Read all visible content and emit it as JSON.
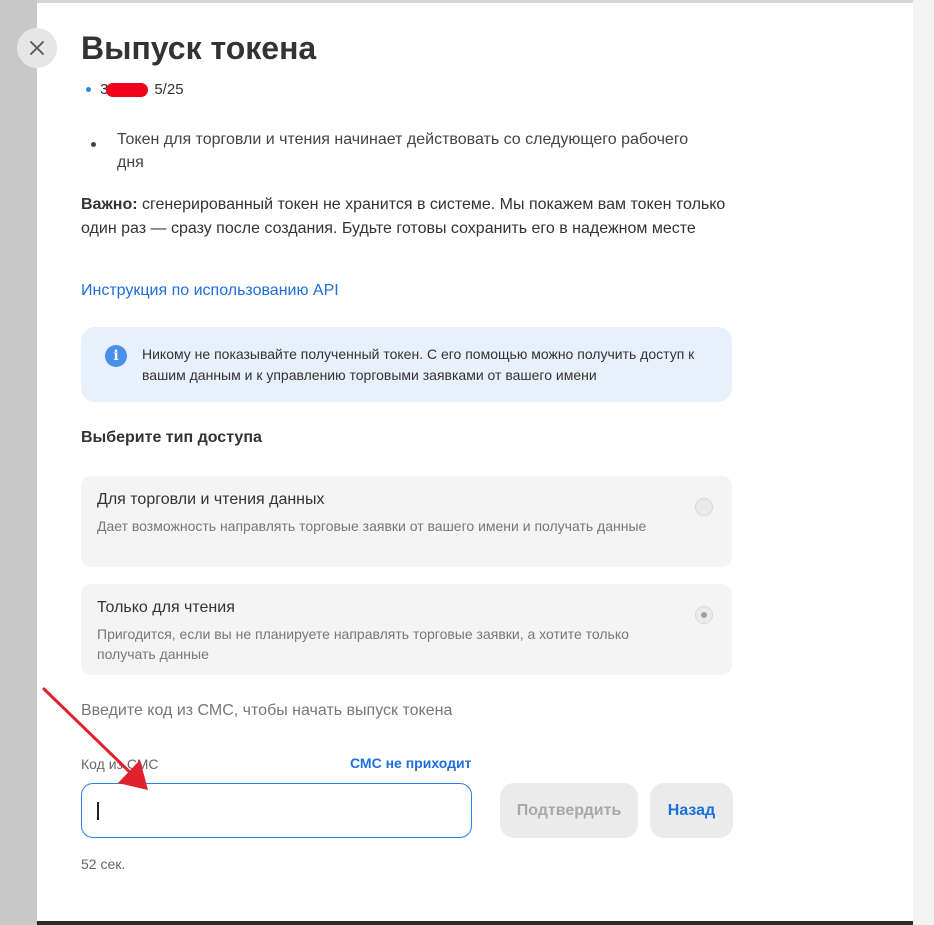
{
  "header": {
    "title": "Выпуск токена",
    "close_icon": "close-icon"
  },
  "subheader": {
    "visible_prefix": "3",
    "visible_suffix": "5/25"
  },
  "bullets": {
    "line1": "Токен для торговли и чтения начинает действовать со следующего рабочего",
    "line2": "дня"
  },
  "important": {
    "label": "Важно:",
    "text": " сгенерированный токен не хранится в системе. Мы покажем вам токен только один раз — сразу после создания. Будьте готовы сохранить его в надежном месте"
  },
  "api_link": "Инструкция по использованию API",
  "info": {
    "icon": "info-icon",
    "text": "Никому не показывайте полученный токен. С его помощью можно получить доступ к вашим данным и к управлению торговыми заявками от вашего имени"
  },
  "access": {
    "title": "Выберите тип доступа",
    "options": [
      {
        "title": "Для торговли и чтения данных",
        "description": "Дает возможность направлять торговые заявки от вашего имени и получать данные",
        "selected": false
      },
      {
        "title": "Только для чтения",
        "description": "Пригодится, если вы не планируете направлять торговые заявки, а хотите только получать данные",
        "selected": true
      }
    ]
  },
  "sms": {
    "prompt": "Введите код из СМС, чтобы начать выпуск токена",
    "label": "Код из СМС",
    "not_received": "СМС не приходит",
    "value": "",
    "confirm_label": "Подтвердить",
    "back_label": "Назад",
    "timer": "52 сек."
  },
  "colors": {
    "accent": "#1d6fdc",
    "info_bg": "#e8f0fc",
    "annotation_arrow": "#e0212e",
    "redaction": "#f0001d"
  }
}
